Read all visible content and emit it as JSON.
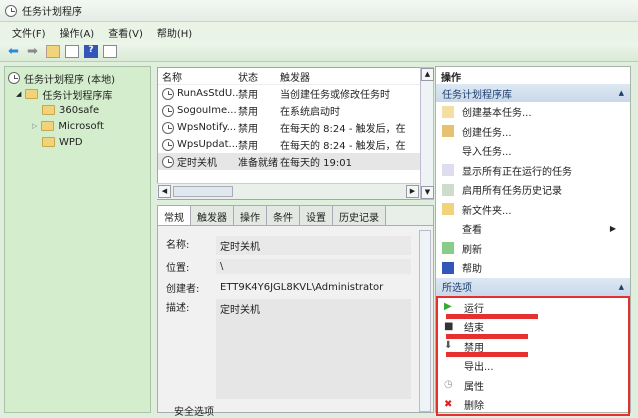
{
  "window": {
    "title": "任务计划程序"
  },
  "menu": [
    "文件(F)",
    "操作(A)",
    "查看(V)",
    "帮助(H)"
  ],
  "tree": {
    "root": "任务计划程序 (本地)",
    "library": "任务计划程序库",
    "folders": [
      "360safe",
      "Microsoft",
      "WPD"
    ]
  },
  "list": {
    "columns": [
      "名称",
      "状态",
      "触发器"
    ],
    "rows": [
      {
        "name": "RunAsStdU...",
        "status": "禁用",
        "trigger": "当创建任务或修改任务时"
      },
      {
        "name": "SogouIme...",
        "status": "禁用",
        "trigger": "在系统启动时"
      },
      {
        "name": "WpsNotify...",
        "status": "禁用",
        "trigger": "在每天的 8:24 - 触发后，在"
      },
      {
        "name": "WpsUpdat...",
        "status": "禁用",
        "trigger": "在每天的 8:24 - 触发后，在"
      },
      {
        "name": "定时关机",
        "status": "准备就绪",
        "trigger": "在每天的 19:01"
      }
    ]
  },
  "details": {
    "tabs": [
      "常规",
      "触发器",
      "操作",
      "条件",
      "设置",
      "历史记录"
    ],
    "name_label": "名称:",
    "name": "定时关机",
    "location_label": "位置:",
    "location": "\\",
    "author_label": "创建者:",
    "author": "ETT9K4Y6JGL8KVL\\Administrator",
    "desc_label": "描述:",
    "desc": "定时关机",
    "security": "安全选项"
  },
  "actions": {
    "title": "操作",
    "section1": "任务计划程序库",
    "items1": [
      "创建基本任务...",
      "创建任务...",
      "导入任务...",
      "显示所有正在运行的任务",
      "启用所有任务历史记录",
      "新文件夹...",
      "查看",
      "刷新",
      "帮助"
    ],
    "section2": "所选项",
    "items2": [
      "运行",
      "结束",
      "禁用",
      "导出...",
      "属性",
      "删除"
    ]
  },
  "colors": {
    "highlight": "#e63030"
  }
}
